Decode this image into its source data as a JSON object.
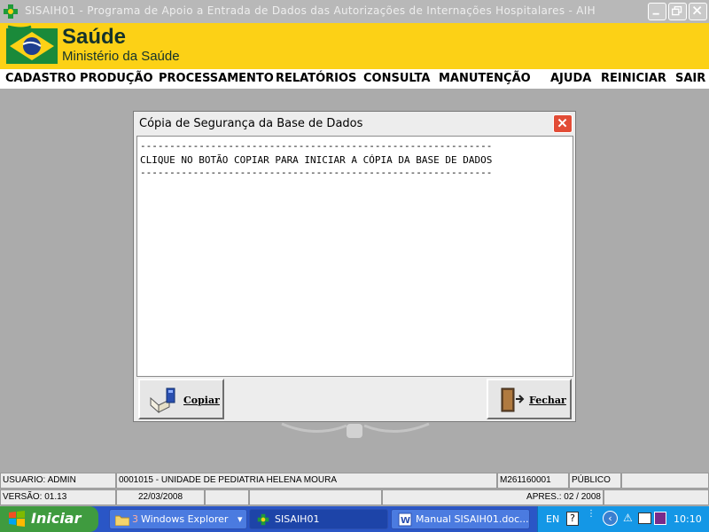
{
  "window": {
    "title": "SISAIH01 - Programa de Apoio a Entrada de Dados das Autorizações de Internações Hospitalares - AIH"
  },
  "banner": {
    "brand": "Saúde",
    "ministry": "Ministério da Saúde"
  },
  "menu": {
    "items": [
      "CADASTRO",
      "PRODUÇÃO",
      "PROCESSAMENTO",
      "RELATÓRIOS",
      "CONSULTA",
      "MANUTENÇÃO",
      "AJUDA",
      "REINICIAR",
      "SAIR"
    ]
  },
  "dialog": {
    "title": "Cópia de Segurança da Base de Dados",
    "message_lines": [
      "------------------------------------------------------------",
      "CLIQUE NO BOTÃO COPIAR PARA INICIAR A CÓPIA DA BASE DE DADOS",
      "------------------------------------------------------------"
    ],
    "copy_button": "Copiar",
    "close_button": "Fechar"
  },
  "status": {
    "user": "USUARIO: ADMIN",
    "unit": "0001015 - UNIDADE DE PEDIATRIA HELENA MOURA",
    "code": "M261160001",
    "type": "PÚBLICO",
    "version": "VERSÃO: 01.13",
    "date": "22/03/2008",
    "presentation": "APRES.: 02 / 2008"
  },
  "taskbar": {
    "start_label": "Iniciar",
    "tasks": [
      {
        "count": "3",
        "label": "Windows Explorer"
      },
      {
        "label": "SISAIH01"
      },
      {
        "label": "Manual SISAIH01.doc..."
      }
    ],
    "language": "EN",
    "clock": "10:10"
  },
  "colors": {
    "banner_yellow": "#fcd116",
    "close_red": "#e24c36",
    "taskbar_blue": "#2a56c6",
    "start_green": "#3f9b3f"
  }
}
